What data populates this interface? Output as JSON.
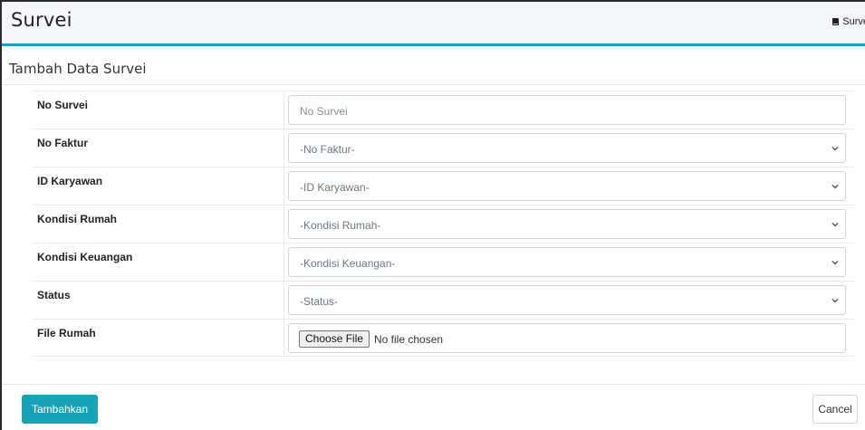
{
  "header": {
    "title": "Survei",
    "breadcrumb": {
      "icon": "book-icon",
      "label": "Surve"
    }
  },
  "card": {
    "title": "Tambah Data Survei"
  },
  "form": {
    "no_survei": {
      "label": "No Survei",
      "placeholder": "No Survei",
      "value": ""
    },
    "no_faktur": {
      "label": "No Faktur",
      "selected": "-No Faktur-"
    },
    "id_karyawan": {
      "label": "ID Karyawan",
      "selected": "-ID Karyawan-"
    },
    "kondisi_rumah": {
      "label": "Kondisi Rumah",
      "selected": "-Kondisi Rumah-"
    },
    "kondisi_keuangan": {
      "label": "Kondisi Keuangan",
      "selected": "-Kondisi Keuangan-"
    },
    "status": {
      "label": "Status",
      "selected": "-Status-"
    },
    "file_rumah": {
      "label": "File Rumah",
      "button": "Choose File",
      "status": "No file chosen"
    }
  },
  "actions": {
    "submit_label": "Tambahkan",
    "cancel_label": "Cancel"
  },
  "colors": {
    "accent": "#17a2b8",
    "header_bg": "#f4f6f9"
  }
}
